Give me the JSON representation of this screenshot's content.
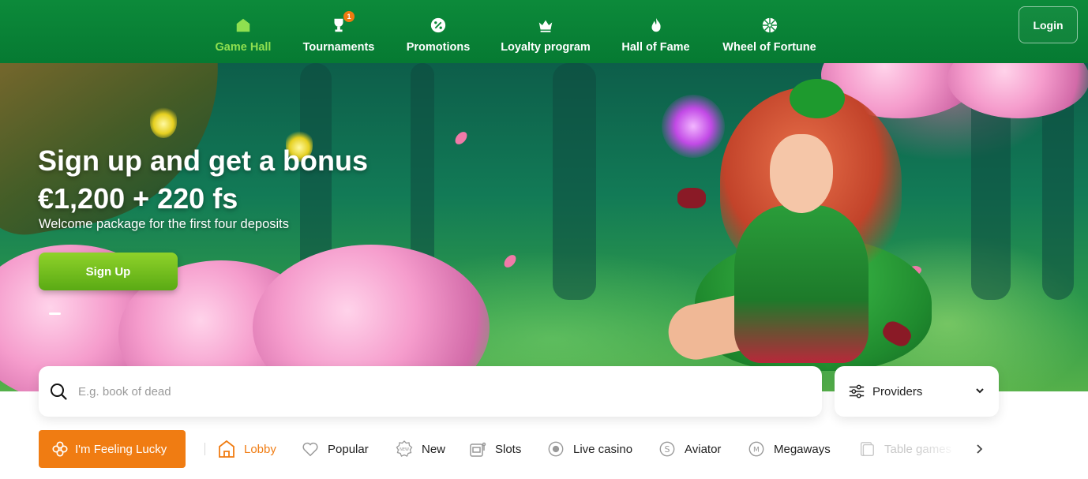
{
  "nav": {
    "items": [
      {
        "label": "Game Hall",
        "icon": "home-icon",
        "active": true
      },
      {
        "label": "Tournaments",
        "icon": "trophy-icon",
        "badge": "1"
      },
      {
        "label": "Promotions",
        "icon": "percent-icon"
      },
      {
        "label": "Loyalty program",
        "icon": "crown-icon"
      },
      {
        "label": "Hall of Fame",
        "icon": "flame-icon"
      },
      {
        "label": "Wheel of Fortune",
        "icon": "wheel-icon"
      }
    ],
    "login_label": "Login"
  },
  "hero": {
    "title_line1": "Sign up and get a bonus",
    "title_line2": "€1,200 + 220 fs",
    "subtitle": "Welcome package for the first four deposits",
    "cta_label": "Sign Up"
  },
  "search": {
    "placeholder": "E.g. book of dead",
    "value": ""
  },
  "providers": {
    "label": "Providers"
  },
  "lucky": {
    "label": "I'm Feeling Lucky"
  },
  "categories": [
    {
      "label": "Lobby",
      "icon": "lobby-icon",
      "active": true
    },
    {
      "label": "Popular",
      "icon": "heart-icon"
    },
    {
      "label": "New",
      "icon": "new-badge-icon"
    },
    {
      "label": "Slots",
      "icon": "slot-machine-icon"
    },
    {
      "label": "Live casino",
      "icon": "live-icon"
    },
    {
      "label": "Aviator",
      "icon": "aviator-icon"
    },
    {
      "label": "Megaways",
      "icon": "megaways-icon"
    },
    {
      "label": "Table games",
      "icon": "table-games-icon"
    }
  ],
  "colors": {
    "header_green": "#0c8a3a",
    "active_nav": "#8fe050",
    "accent_orange": "#f07c12",
    "cta_green": "#6cbc1a"
  }
}
